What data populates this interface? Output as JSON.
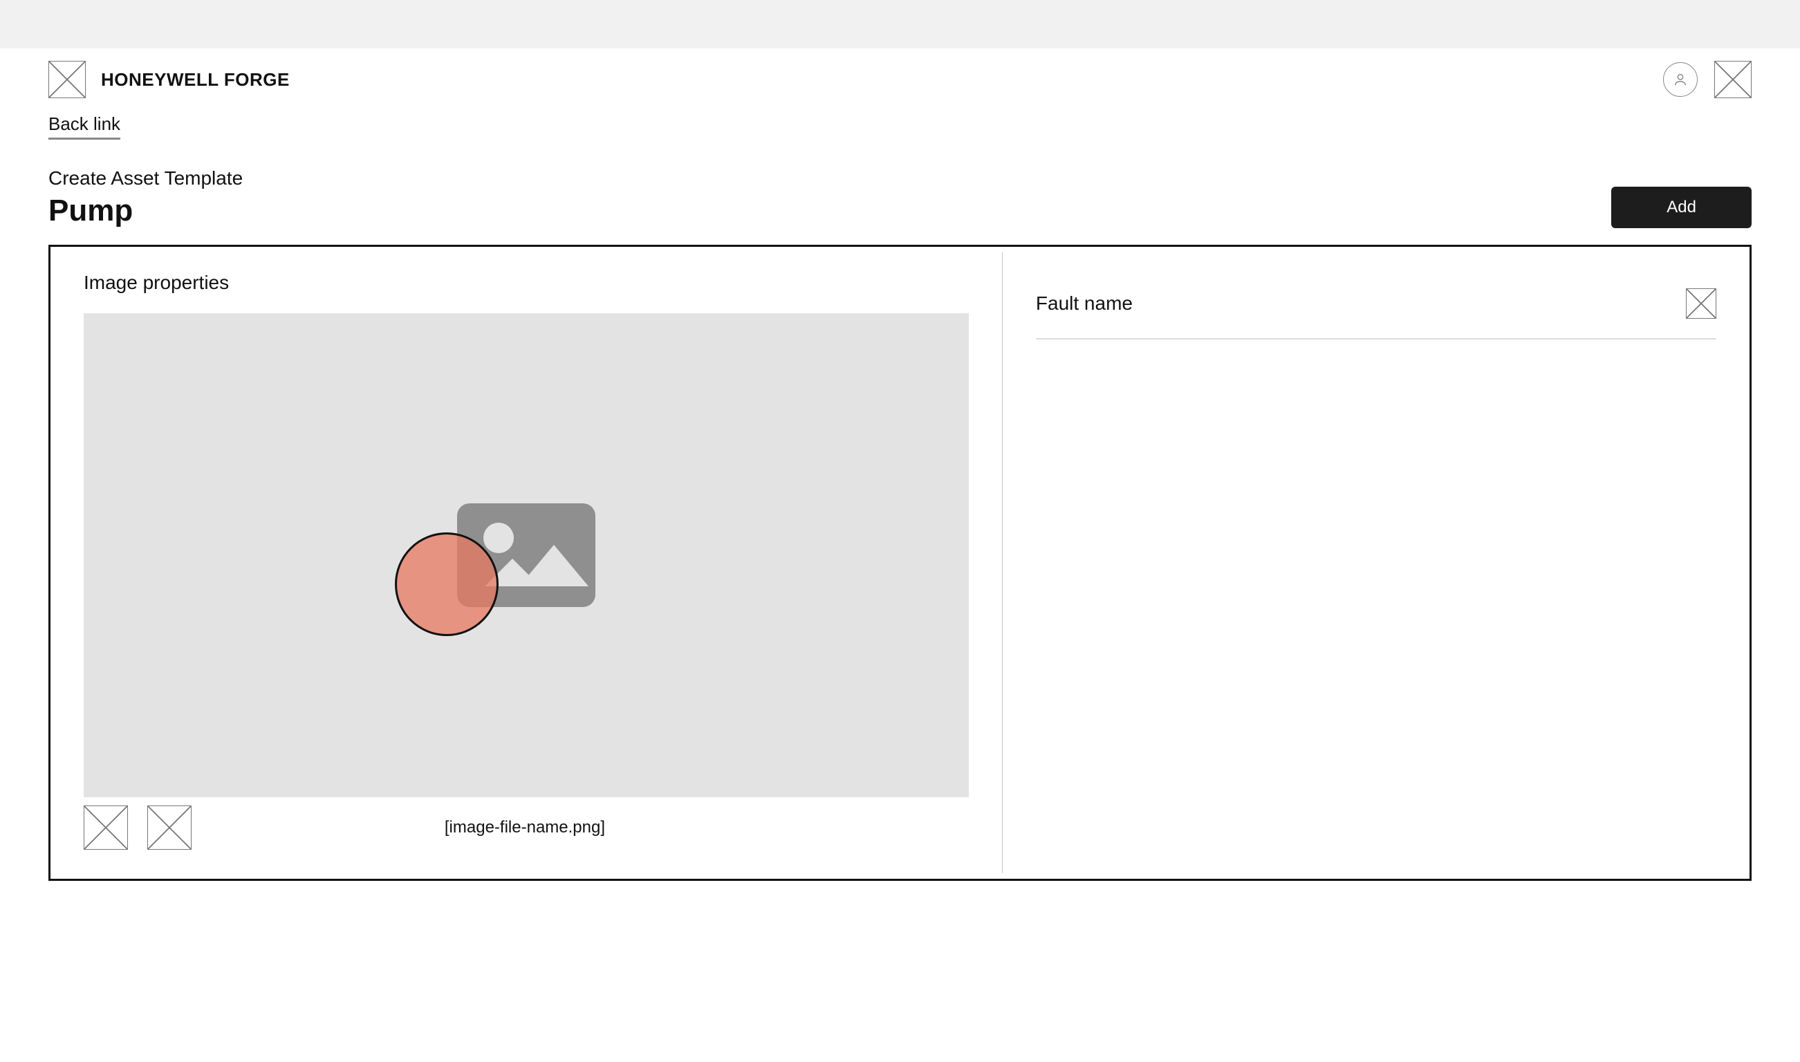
{
  "header": {
    "brand": "HONEYWELL FORGE"
  },
  "nav": {
    "back_link_label": "Back link"
  },
  "page_title": {
    "subtitle": "Create Asset Template",
    "title": "Pump"
  },
  "actions": {
    "add_label": "Add"
  },
  "image_panel": {
    "heading": "Image properties",
    "filename": "[image-file-name.png]"
  },
  "fault_panel": {
    "label": "Fault name"
  }
}
